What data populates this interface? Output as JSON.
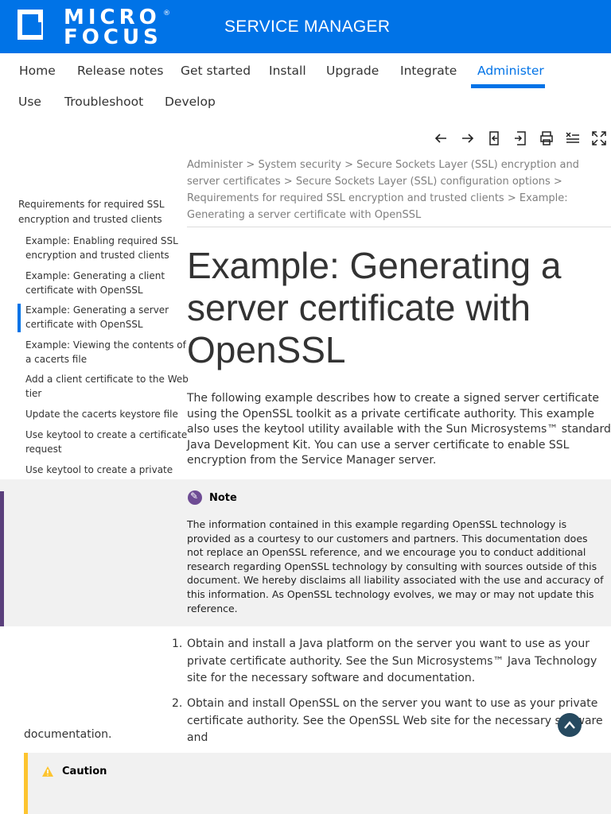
{
  "header": {
    "logo_line1": "MICRO",
    "logo_line2": "FOCUS",
    "logo_reg": "®",
    "product": "SERVICE MANAGER",
    "bg_color": "#0073e7"
  },
  "nav": {
    "items": [
      "Home",
      "Release notes",
      "Get started",
      "Install",
      "Upgrade",
      "Integrate",
      "Administer",
      "Use",
      "Troubleshoot",
      "Develop"
    ],
    "active": "Administer"
  },
  "toolbar": {
    "icons": [
      "arrow-left-icon",
      "arrow-right-icon",
      "collapse-toc-icon",
      "expand-toc-icon",
      "print-icon",
      "remove-highlight-icon",
      "fullscreen-icon"
    ]
  },
  "breadcrumb": {
    "items": [
      "Administer",
      "System security",
      "Secure Sockets Layer (SSL) encryption and server certificates",
      "Secure Sockets Layer (SSL) configuration options",
      "Requirements for required SSL encryption and trusted clients",
      "Example: Generating a server certificate with OpenSSL"
    ],
    "separator": ">"
  },
  "toc": {
    "parent": "Requirements for required SSL encryption and trusted clients",
    "items": [
      "Example: Enabling required SSL encryption and trusted clients",
      "Example: Generating a client certificate with OpenSSL",
      "Example: Generating a server certificate with OpenSSL",
      "Example: Viewing the contents of a cacerts file",
      "Add a client certificate to the Web tier",
      "Update the cacerts keystore file",
      "Use keytool to create a certificate request",
      "Use keytool to create a private key"
    ],
    "active_index": 2
  },
  "page": {
    "title": "Example: Generating a server certificate with OpenSSL",
    "intro": "The following example describes how to create a signed server certificate using the OpenSSL toolkit as a private certificate authority. This example also uses the keytool utility available with the Sun Microsystems™ standard Java Development Kit. You can use a server certificate to enable SSL encryption from the Service Manager server."
  },
  "note": {
    "title": "Note",
    "body": "The information contained in this example regarding OpenSSL technology is provided as a courtesy to our customers and partners. This documentation does not replace an OpenSSL reference, and we encourage you to conduct additional research regarding OpenSSL technology by consulting with sources outside of this document. We hereby disclaims all liability associated with the use and accuracy of this information. As OpenSSL technology evolves, we may or may not update this reference.",
    "accent": "#5a3f7c"
  },
  "steps": [
    {
      "num": "1.",
      "text": "Obtain and install a Java platform on the server you want to use as your private certificate authority. See the Sun Microsystems™ Java Technology site for the necessary software and documentation."
    },
    {
      "num": "2.",
      "text": "Obtain and install OpenSSL on the server you want to use as your private certificate authority. See the OpenSSL Web site for the necessary software and",
      "tail": "documentation."
    }
  ],
  "caution": {
    "title": "Caution",
    "accent": "#fdc42f"
  }
}
